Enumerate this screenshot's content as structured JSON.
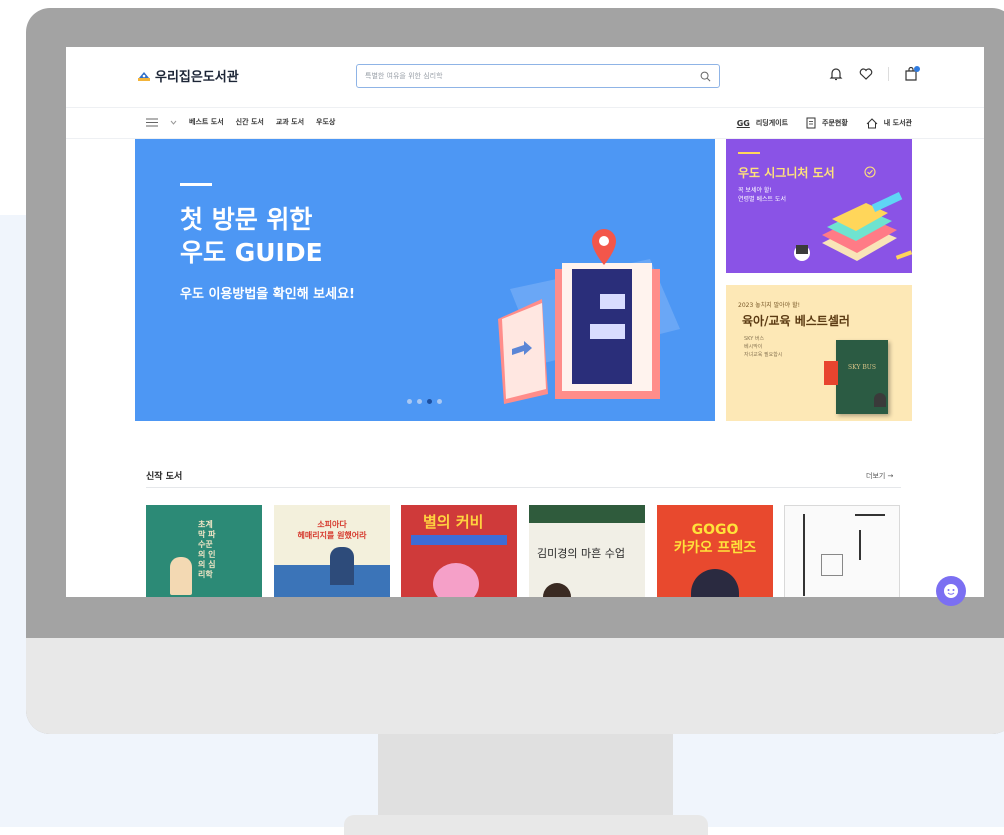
{
  "header": {
    "logo_text": "우리집은도서관",
    "search_placeholder": "특별한 여유을 위한 심리학"
  },
  "nav": {
    "left_items": [
      "베스트 도서",
      "신간 도서",
      "교과 도서",
      "우도상"
    ],
    "right_items": [
      {
        "icon": "reading-gate-icon",
        "badge": "GG",
        "label": "리딩게이트"
      },
      {
        "icon": "order-icon",
        "label": "주문현황"
      },
      {
        "icon": "home-icon",
        "label": "내 도서관"
      }
    ]
  },
  "banner": {
    "title": "첫 방문 위한\n우도 GUIDE",
    "subtitle": "우도 이용방법을 확인해 보세요!",
    "dots": 4,
    "active_dot": 3
  },
  "side_banner_1": {
    "title": "우도 시그니처 도서",
    "subtitle": "꼭 보세야 할!\n연령별 베스트 도서"
  },
  "side_banner_2": {
    "pretitle": "2023 놓치지 말아야 할!",
    "title": "육아/교육 베스트셀러",
    "subtitle": "SKY 버스\n베시막이\n자녀교육 필요합시",
    "book_label": "SKY BUS"
  },
  "new_books": {
    "title": "신작 도서",
    "more": "더보기 →",
    "books": [
      {
        "cover_text": "초계막 파수꾼의 인의 심리학"
      },
      {
        "cover_text": "소피아다\n헤매리지를 원했어라"
      },
      {
        "cover_text": "별의 커비"
      },
      {
        "cover_text": "김미경의 마흔 수업"
      },
      {
        "cover_text": "GOGO\n카카오 프렌즈"
      },
      {
        "cover_text": ""
      }
    ]
  },
  "colors": {
    "banner_blue": "#4d97f4",
    "signature_purple": "#8a53e6",
    "edu_yellow": "#fde8b6",
    "chat_button": "#7b6ff2"
  }
}
